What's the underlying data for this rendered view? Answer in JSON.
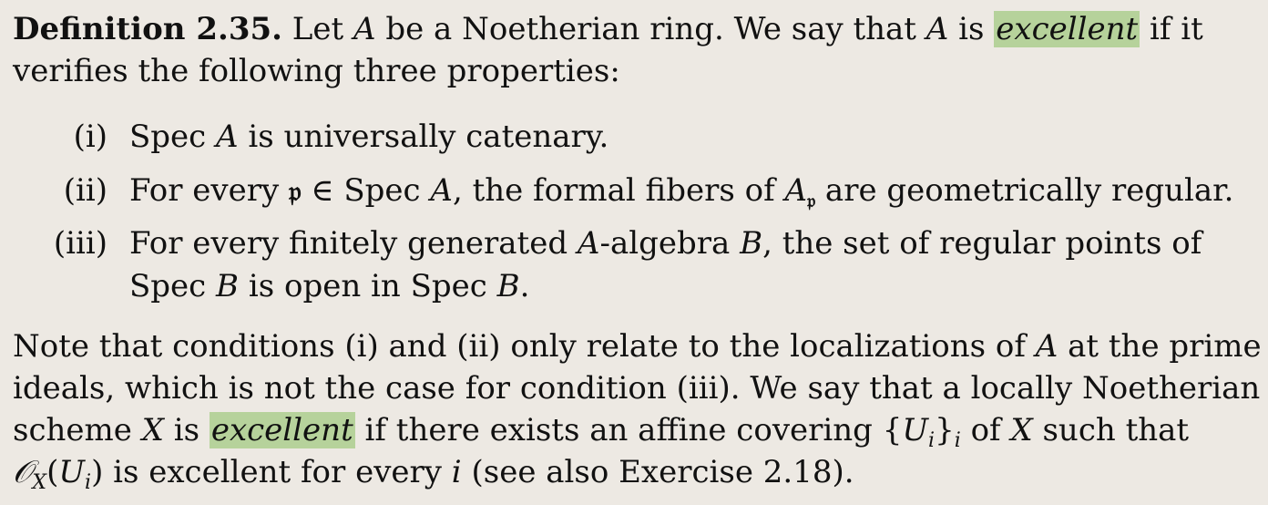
{
  "definition": {
    "heading": "Definition 2.35.",
    "line1_pre": " Let ",
    "A": "A",
    "line1_mid": " be a Noetherian ring. We say that ",
    "line1_mid2": " is ",
    "term": "excellent",
    "line1_post": " if it",
    "line2": "verifies the following three properties:"
  },
  "items": [
    {
      "label": "(i)",
      "parts": [
        "Spec ",
        "A",
        " is universally catenary."
      ]
    },
    {
      "label": "(ii)",
      "parts": [
        "For every ",
        "𝔭",
        " ∈ Spec ",
        "A",
        ", the formal fibers of ",
        "A",
        "𝔭",
        " are geometrically regular."
      ]
    },
    {
      "label": "(iii)",
      "line1_parts": [
        "For every finitely generated ",
        "A",
        "-algebra ",
        "B",
        ", the set of regular points of"
      ],
      "line2_parts": [
        "Spec ",
        "B",
        " is open in Spec ",
        "B",
        "."
      ]
    }
  ],
  "note": {
    "line1_pre": "Note that conditions (i) and (ii) only relate to the localizations of ",
    "line1_A": "A",
    "line1_post": " at the prime",
    "line2": "ideals, which is not the case for condition (iii). We say that a locally Noetherian",
    "line3_pre": "scheme ",
    "line3_X": "X",
    "line3_is": " is ",
    "line3_term": "excellent",
    "line3_mid": " if there exists an affine covering {",
    "line3_U": "U",
    "line3_i": "i",
    "line3_close": "}",
    "line3_isub": "i",
    "line3_of": " of ",
    "line3_X2": "X",
    "line3_post": " such that",
    "line4_O": "𝒪",
    "line4_Xsub": "X",
    "line4_open": "(",
    "line4_U": "U",
    "line4_i": "i",
    "line4_mid": ") is excellent for every ",
    "line4_ivar": "i",
    "line4_post": " (see also Exercise 2.18)."
  }
}
